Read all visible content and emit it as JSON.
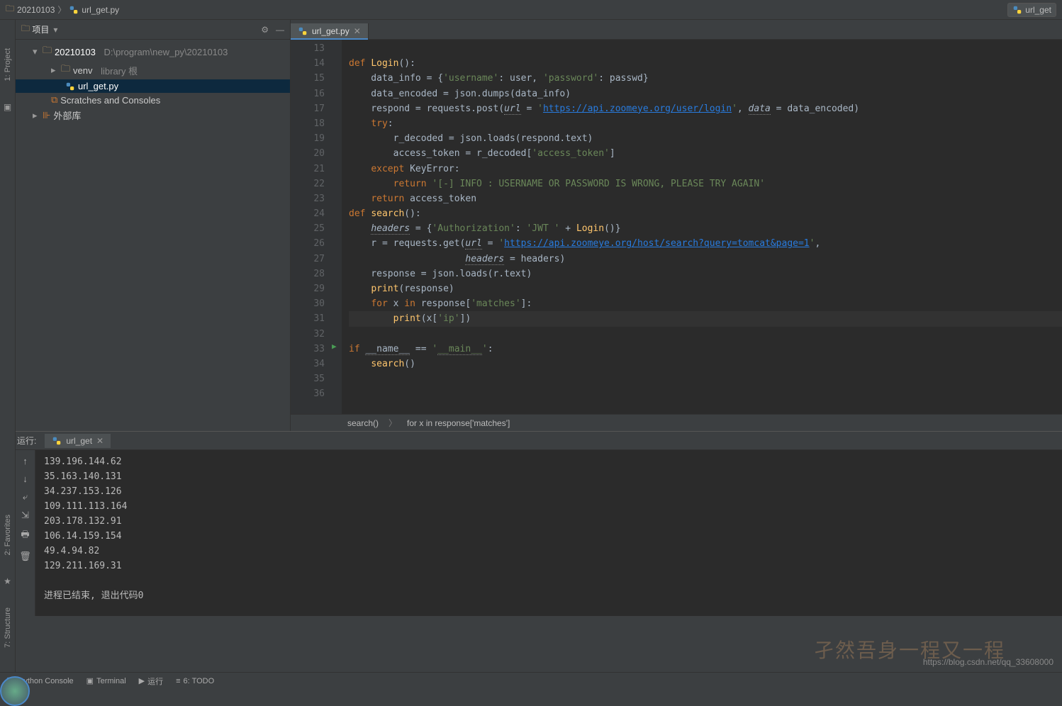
{
  "breadcrumb": {
    "root": "20210103",
    "file": "url_get.py",
    "right_file": "url_get"
  },
  "project": {
    "panel_title": "项目",
    "root": "20210103",
    "root_path": "D:\\program\\new_py\\20210103",
    "venv": "venv",
    "venv_hint": "library 根",
    "file": "url_get.py",
    "scratches": "Scratches and Consoles",
    "external": "外部库"
  },
  "tab": {
    "name": "url_get.py"
  },
  "crumb": {
    "a": "search()",
    "b": "for x in response['matches']"
  },
  "gutter": {
    "start": 13,
    "end": 36,
    "run_marker_line": 33
  },
  "code": [
    "",
    "def Login():",
    "    data_info = {'username': user, 'password': passwd}",
    "    data_encoded = json.dumps(data_info)",
    "    respond = requests.post(url = 'https://api.zoomeye.org/user/login', data = data_encoded)",
    "    try:",
    "        r_decoded = json.loads(respond.text)",
    "        access_token = r_decoded['access_token']",
    "    except KeyError:",
    "        return '[-] INFO : USERNAME OR PASSWORD IS WRONG, PLEASE TRY AGAIN'",
    "    return access_token",
    "def search():",
    "    headers = {'Authorization': 'JWT ' + Login()}",
    "    r = requests.get(url = 'https://api.zoomeye.org/host/search?query=tomcat&page=1',",
    "                     headers = headers)",
    "    response = json.loads(r.text)",
    "    print(response)",
    "    for x in response['matches']:",
    "        print(x['ip'])",
    "",
    "if __name__ == '__main__':",
    "    search()",
    "",
    ""
  ],
  "run": {
    "label": "运行:",
    "tab": "url_get",
    "output": [
      "139.196.144.62",
      "35.163.140.131",
      "34.237.153.126",
      "109.111.113.164",
      "203.178.132.91",
      "106.14.159.154",
      "49.4.94.82",
      "129.211.169.31",
      "",
      "进程已结束, 退出代码0"
    ]
  },
  "status": {
    "console": "Python Console",
    "terminal": "Terminal",
    "run": "运行",
    "todo": "6: TODO"
  },
  "sidetabs": {
    "project": "1: Project",
    "fav": "2: Favorites",
    "struct": "7: Structure"
  },
  "watermark": "孑然吾身一程又一程",
  "url_wm": "https://blog.csdn.net/qq_33608000"
}
